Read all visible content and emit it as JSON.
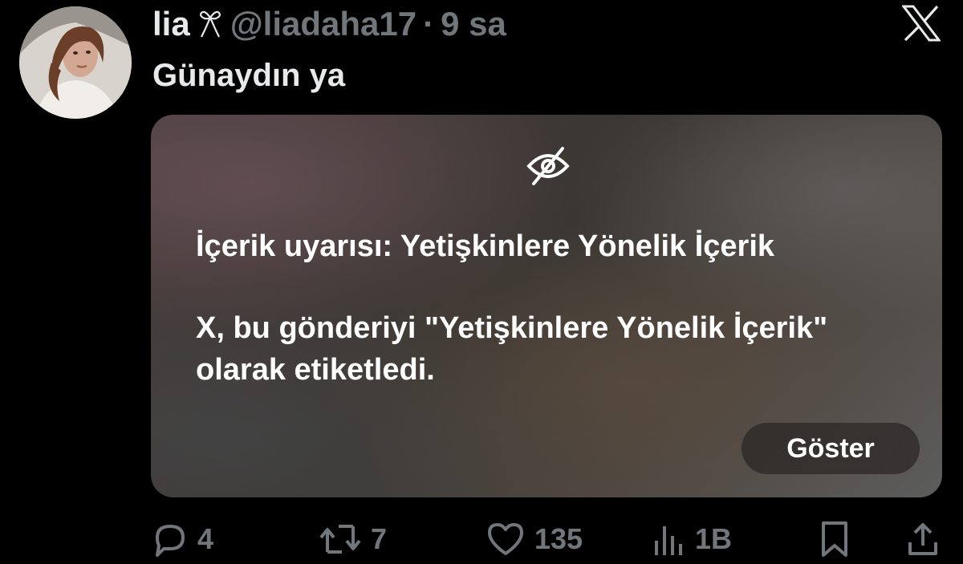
{
  "tweet": {
    "display_name": "lia",
    "name_icon": "bow-icon",
    "handle": "@liadaha17",
    "separator": "·",
    "time": "9 sa",
    "text": "Günaydın ya"
  },
  "platform_icon": "x-logo-icon",
  "warning": {
    "icon": "eye-off-icon",
    "title": "İçerik uyarısı: Yetişkinlere Yönelik İçerik",
    "description": "X, bu gönderiyi \"Yetişkinlere Yönelik İçerik\" olarak etiketledi.",
    "show_button": "Göster"
  },
  "actions": {
    "replies": "4",
    "reposts": "7",
    "likes": "135",
    "views": "1B",
    "icons": [
      "reply-icon",
      "repost-icon",
      "like-icon",
      "views-icon",
      "bookmark-icon",
      "share-icon"
    ]
  },
  "colors": {
    "background": "#000000",
    "text_primary": "#e7e9ea",
    "text_secondary": "#71767b"
  }
}
